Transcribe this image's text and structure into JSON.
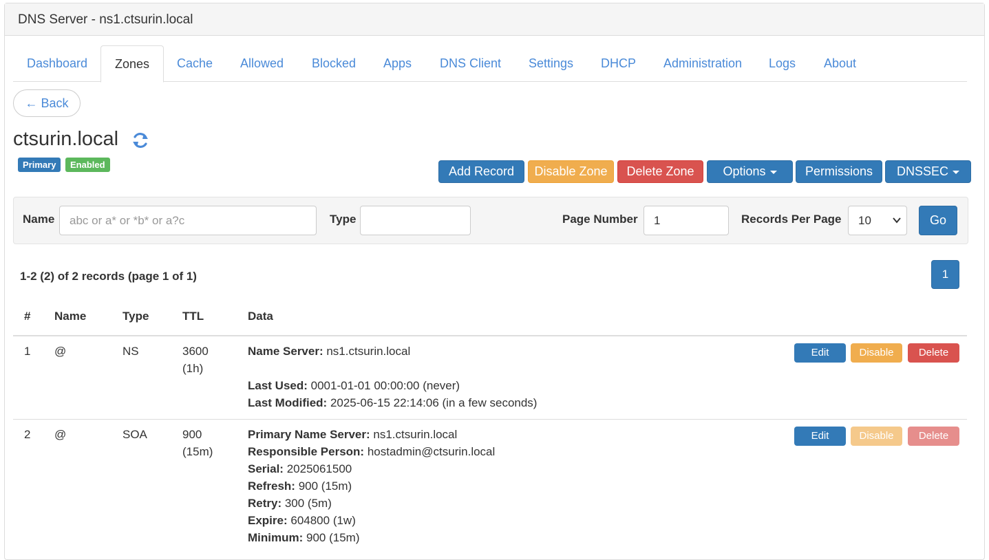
{
  "window": {
    "title": "DNS Server - ns1.ctsurin.local"
  },
  "tabs": [
    {
      "label": "Dashboard"
    },
    {
      "label": "Zones"
    },
    {
      "label": "Cache"
    },
    {
      "label": "Allowed"
    },
    {
      "label": "Blocked"
    },
    {
      "label": "Apps"
    },
    {
      "label": "DNS Client"
    },
    {
      "label": "Settings"
    },
    {
      "label": "DHCP"
    },
    {
      "label": "Administration"
    },
    {
      "label": "Logs"
    },
    {
      "label": "About"
    }
  ],
  "active_tab": "Zones",
  "back_button": "← Back",
  "zone": {
    "name": "ctsurin.local",
    "badges": {
      "type": "Primary",
      "status": "Enabled"
    }
  },
  "toolbar": {
    "add_record": "Add Record",
    "disable_zone": "Disable Zone",
    "delete_zone": "Delete Zone",
    "options": "Options",
    "permissions": "Permissions",
    "dnssec": "DNSSEC"
  },
  "filter": {
    "name_label": "Name",
    "name_placeholder": "abc or a* or *b* or a?c",
    "name_value": "",
    "type_label": "Type",
    "type_value": "",
    "page_number_label": "Page Number",
    "page_number_value": "1",
    "records_per_page_label": "Records Per Page",
    "records_per_page_value": "10",
    "go_button": "Go"
  },
  "summary": "1-2 (2) of 2 records (page 1 of 1)",
  "pagination": {
    "current": "1"
  },
  "table": {
    "headers": {
      "num": "#",
      "name": "Name",
      "type": "Type",
      "ttl": "TTL",
      "data": "Data"
    },
    "rows": [
      {
        "num": "1",
        "name": "@",
        "type": "NS",
        "ttl": "3600",
        "ttl_human": "(1h)",
        "data": [
          {
            "label": "Name Server:",
            "value": " ns1.ctsurin.local"
          },
          {
            "label": "Last Used:",
            "value": " 0001-01-01 00:00:00 (never)"
          },
          {
            "label": "Last Modified:",
            "value": " 2025-06-15 22:14:06 (in a few seconds)"
          }
        ],
        "actions": {
          "edit": "Edit",
          "disable": "Disable",
          "delete": "Delete",
          "enabled": true
        }
      },
      {
        "num": "2",
        "name": "@",
        "type": "SOA",
        "ttl": "900",
        "ttl_human": "(15m)",
        "data": [
          {
            "label": "Primary Name Server:",
            "value": " ns1.ctsurin.local"
          },
          {
            "label": "Responsible Person:",
            "value": " hostadmin@ctsurin.local"
          },
          {
            "label": "Serial:",
            "value": " 2025061500"
          },
          {
            "label": "Refresh:",
            "value": " 900 (15m)"
          },
          {
            "label": "Retry:",
            "value": " 300 (5m)"
          },
          {
            "label": "Expire:",
            "value": " 604800 (1w)"
          },
          {
            "label": "Minimum:",
            "value": " 900 (15m)"
          }
        ],
        "actions": {
          "edit": "Edit",
          "disable": "Disable",
          "delete": "Delete",
          "enabled": false
        }
      }
    ]
  },
  "colors": {
    "primary": "#337ab7",
    "warning": "#f0ad4e",
    "danger": "#d9534f",
    "success": "#5cb85c",
    "link": "#4a8ad8"
  }
}
